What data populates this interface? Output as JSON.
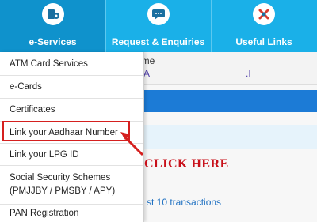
{
  "nav": {
    "tabs": [
      {
        "label": "e-Services",
        "icon": "eservices-icon",
        "active": true
      },
      {
        "label": "Request & Enquiries",
        "icon": "phone-chat-icon",
        "active": false
      },
      {
        "label": "Useful Links",
        "icon": "links-icon",
        "active": false
      }
    ]
  },
  "dropdown": {
    "items": [
      {
        "label": "ATM Card Services"
      },
      {
        "label": "e-Cards"
      },
      {
        "label": "Certificates"
      },
      {
        "label": "Link your Aadhaar Number"
      },
      {
        "label": "Link your LPG ID"
      },
      {
        "label_line1": "Social Security Schemes",
        "label_line2": "(PMJJBY / PMSBY / APY)"
      },
      {
        "label": "PAN Registration"
      }
    ]
  },
  "annotation": {
    "text": "CLICK HERE",
    "color": "#c8101a"
  },
  "background": {
    "home_partial": "ome",
    "letter_a": "A",
    "letter_j": ".I",
    "transactions_link": "st 10 transactions"
  },
  "colors": {
    "navbar": "#1ab0e8",
    "active_tab": "#0f92cc",
    "highlight": "#d5201f"
  }
}
